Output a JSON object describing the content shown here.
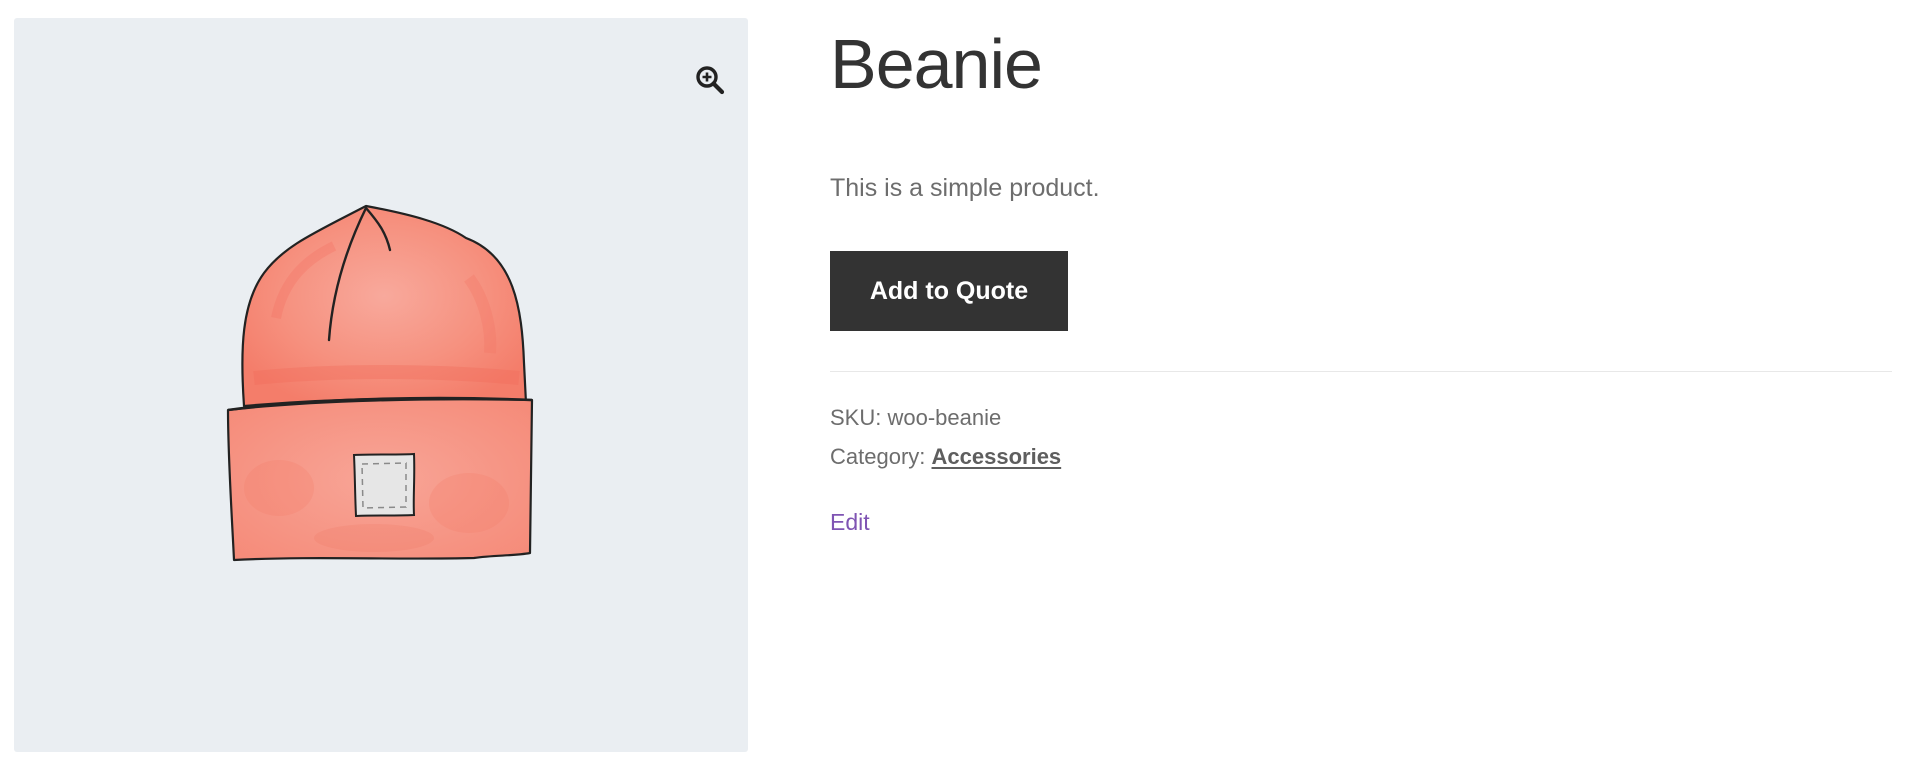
{
  "product": {
    "title": "Beanie",
    "short_description": "This is a simple product.",
    "image_alt": "Beanie",
    "zoom_icon": "zoom-in-magnifier-icon"
  },
  "actions": {
    "add_to_quote_label": "Add to Quote",
    "edit_label": "Edit"
  },
  "meta": {
    "sku_label": "SKU:",
    "sku_value": "woo-beanie",
    "category_label": "Category:",
    "category_value": "Accessories"
  },
  "colors": {
    "gallery_bg": "#eaeef2",
    "button_bg": "#333333",
    "button_text": "#ffffff",
    "edit_link": "#7f54b3",
    "beanie_body": "#f6897a"
  }
}
